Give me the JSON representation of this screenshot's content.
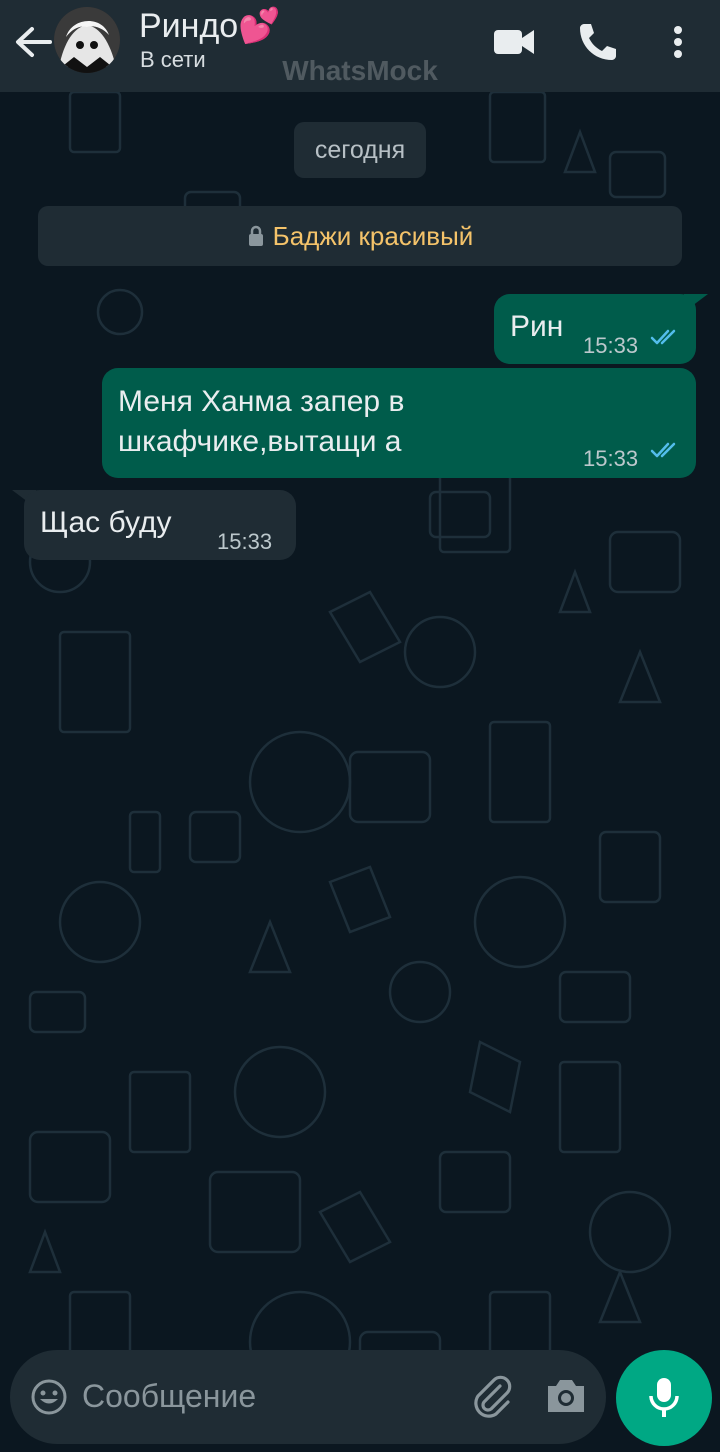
{
  "header": {
    "contact_name": "Риндо💕",
    "status": "В сети",
    "watermark": "WhatsMock"
  },
  "chat": {
    "date_label": "сегодня",
    "notice": "Баджи красивый",
    "messages": [
      {
        "direction": "out",
        "text": "Рин",
        "time": "15:33",
        "status": "read"
      },
      {
        "direction": "out",
        "text_lines": [
          "Меня Ханма запер в",
          "шкафчике,вытащи а"
        ],
        "time": "15:33",
        "status": "read"
      },
      {
        "direction": "in",
        "text": "Щас буду",
        "time": "15:33"
      }
    ]
  },
  "composer": {
    "placeholder": "Сообщение"
  },
  "colors": {
    "header_bg": "#1f2c34",
    "chat_bg": "#0b1720",
    "outgoing_bubble": "#005c4b",
    "incoming_bubble": "#1f2c34",
    "accent": "#00a884",
    "read_ticks": "#53bdeb",
    "notice_text": "#f4c36a"
  },
  "icons": [
    "back-arrow-icon",
    "video-call-icon",
    "phone-icon",
    "more-vert-icon",
    "lock-icon",
    "double-check-icon",
    "emoji-icon",
    "attach-icon",
    "camera-icon",
    "mic-icon"
  ]
}
